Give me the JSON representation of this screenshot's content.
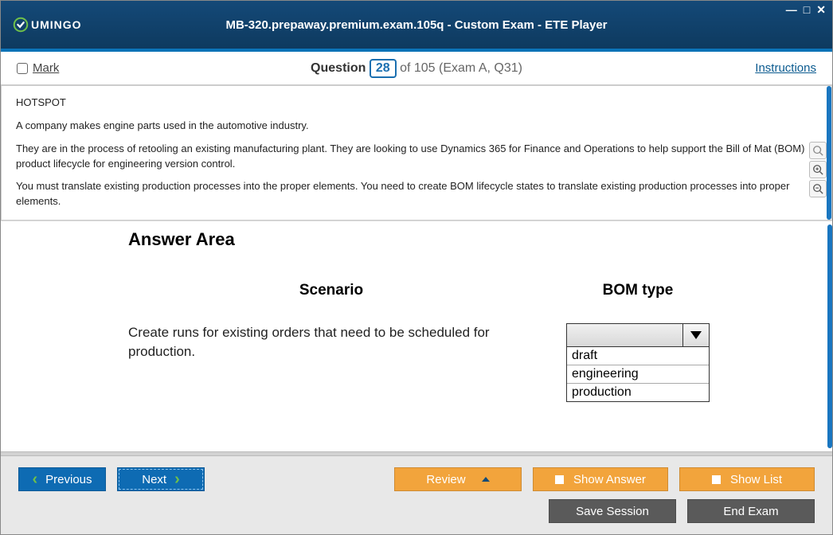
{
  "window": {
    "logo_text": "UMINGO",
    "title": "MB-320.prepaway.premium.exam.105q - Custom Exam - ETE Player"
  },
  "header": {
    "mark_label": "Mark",
    "question_label": "Question",
    "current_number": "28",
    "total_suffix": "of 105 (Exam A, Q31)",
    "instructions_label": "Instructions"
  },
  "question": {
    "tag": "HOTSPOT",
    "p1": "A company makes engine parts used in the automotive industry.",
    "p2": "They are in the process of retooling an existing manufacturing plant. They are looking to use Dynamics 365 for Finance and Operations to help support the Bill of Mat (BOM) product lifecycle for engineering version control.",
    "p3": "You must translate existing production processes into the proper elements. You need to create BOM lifecycle states to translate existing production processes into proper elements."
  },
  "answer": {
    "area_title": "Answer Area",
    "scenario_head": "Scenario",
    "bom_head": "BOM type",
    "scenario_text": "Create runs for existing orders that need to be scheduled for production.",
    "options": [
      "draft",
      "engineering",
      "production"
    ]
  },
  "footer": {
    "previous": "Previous",
    "next": "Next",
    "review": "Review",
    "show_answer": "Show Answer",
    "show_list": "Show List",
    "save_session": "Save Session",
    "end_exam": "End Exam"
  }
}
